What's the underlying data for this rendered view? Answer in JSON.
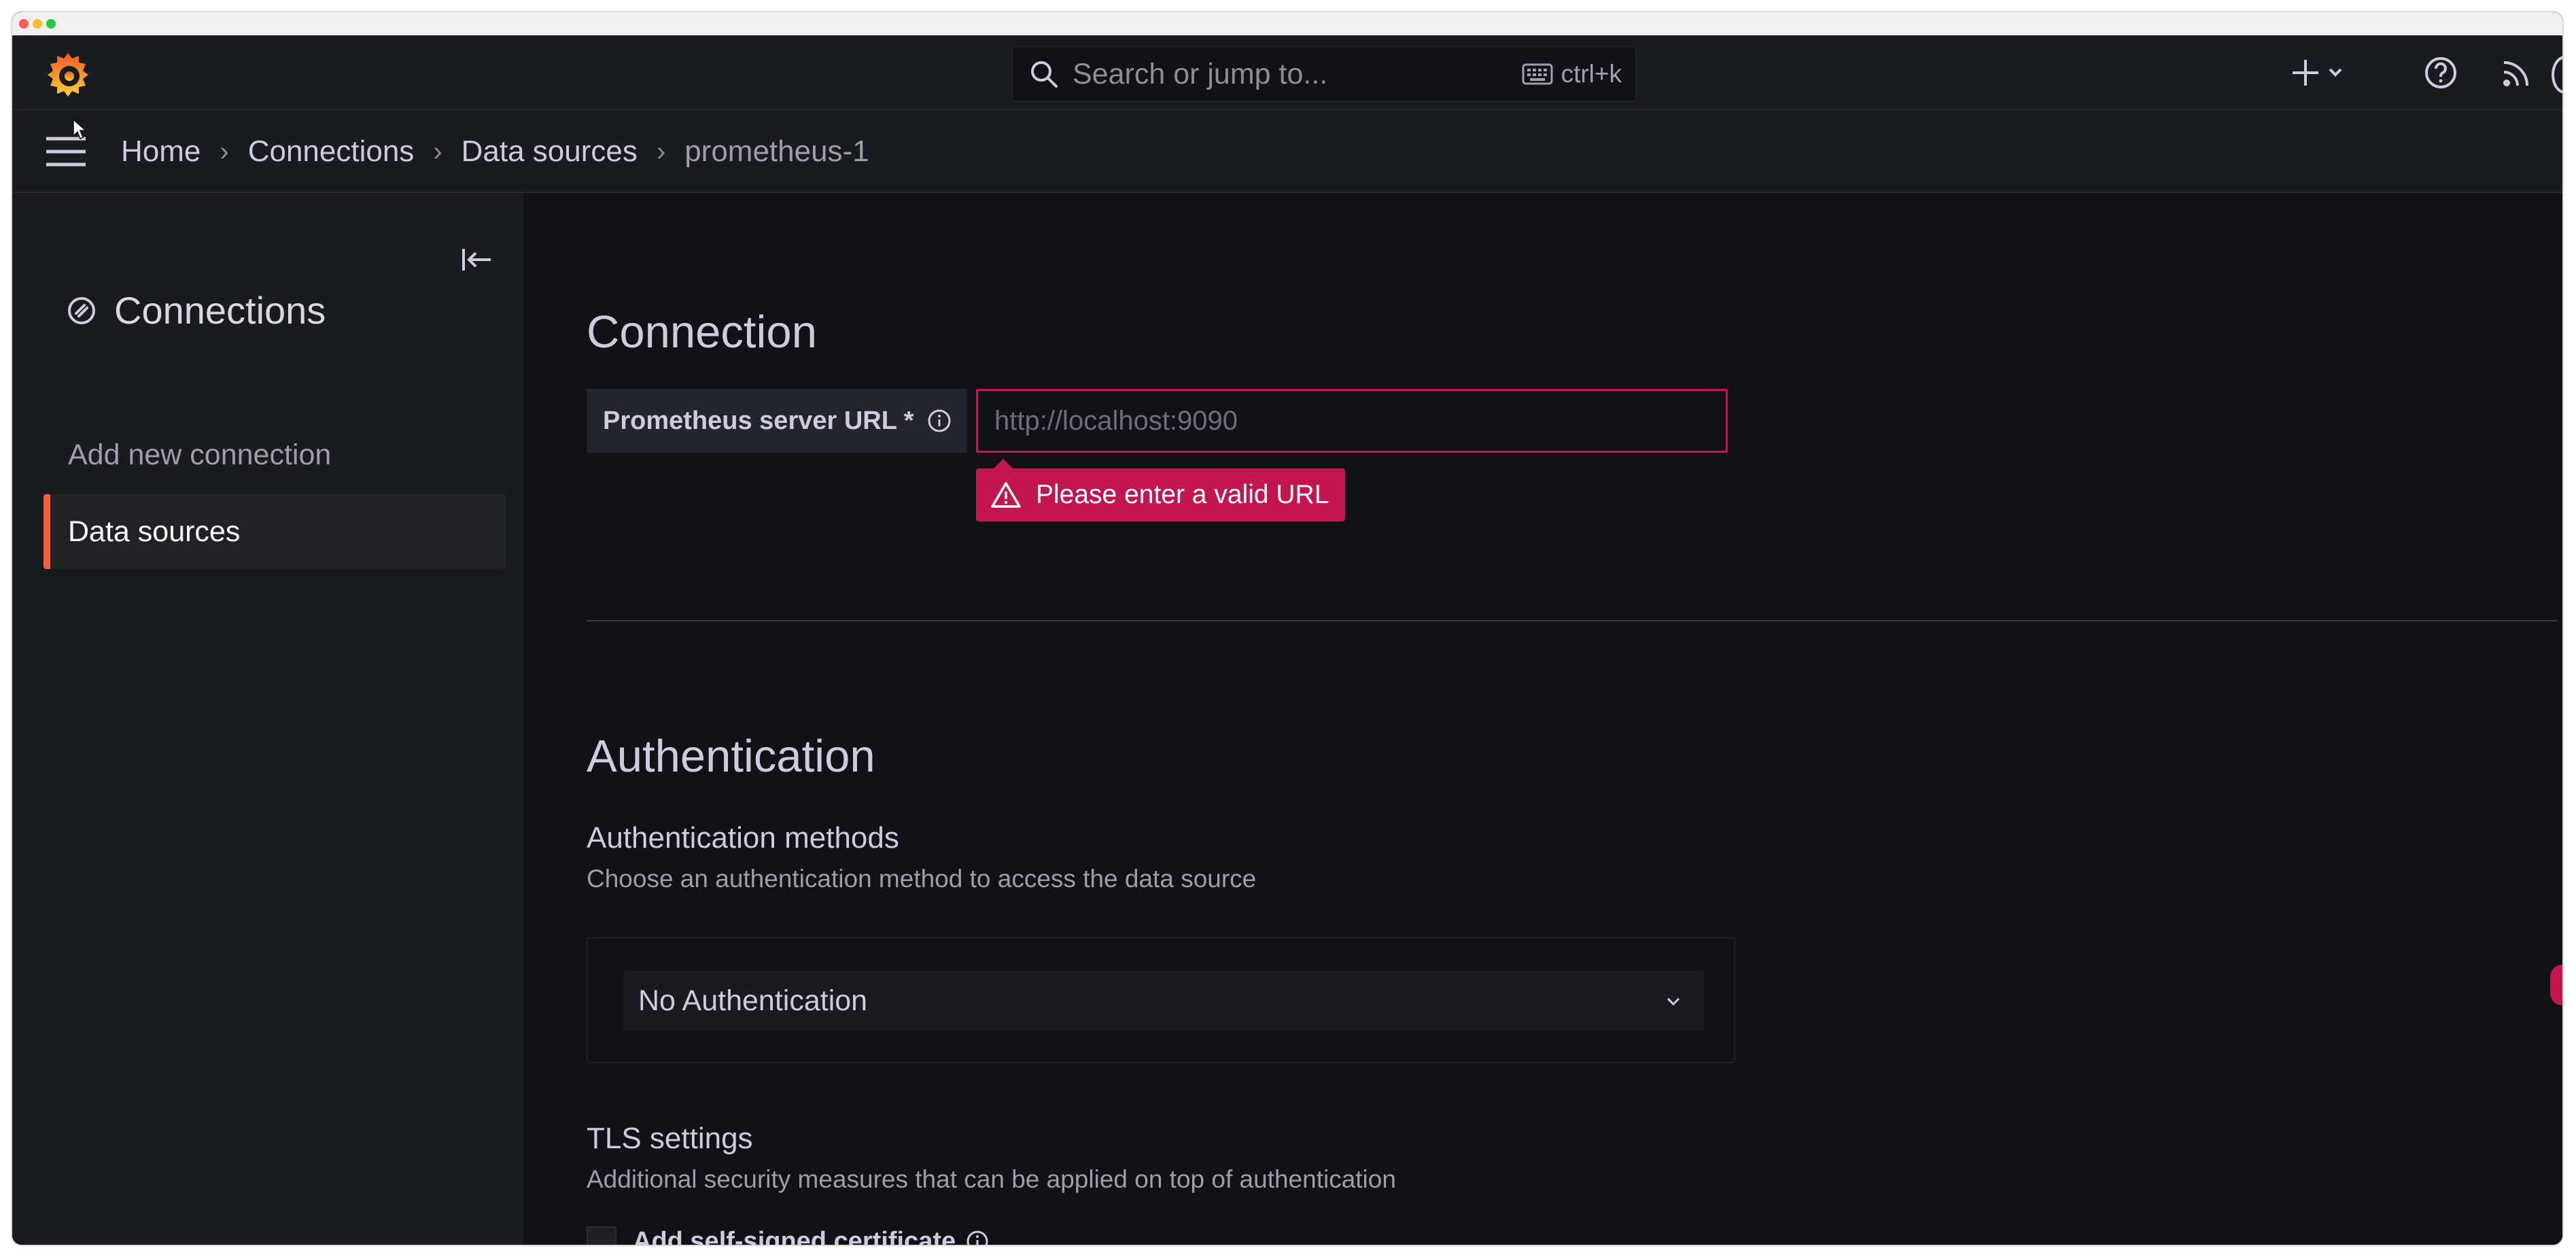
{
  "window": {
    "traffic_lights": [
      "close",
      "minimize",
      "maximize"
    ]
  },
  "topbar": {
    "search_placeholder": "Search or jump to...",
    "search_shortcut": "ctrl+k",
    "icons": [
      "grafana-logo-icon",
      "search-icon",
      "keyboard-icon",
      "plus-icon",
      "chevron-down-icon",
      "help-icon",
      "rss-icon",
      "avatar"
    ]
  },
  "breadcrumb": {
    "items": [
      "Home",
      "Connections",
      "Data sources",
      "prometheus-1"
    ]
  },
  "sidebar": {
    "title": "Connections",
    "items": [
      {
        "label": "Add new connection"
      },
      {
        "label": "Data sources",
        "active": true
      }
    ]
  },
  "main": {
    "connection_heading": "Connection",
    "url_label": "Prometheus server URL *",
    "url_placeholder": "http://localhost:9090",
    "url_value": "",
    "url_error": "Please enter a valid URL",
    "auth_heading": "Authentication",
    "auth_methods_title": "Authentication methods",
    "auth_methods_desc": "Choose an authentication method to access the data source",
    "auth_selected": "No Authentication",
    "tls_title": "TLS settings",
    "tls_desc": "Additional security measures that can be applied on top of authentication",
    "self_signed_label": "Add self-signed certificate"
  },
  "colors": {
    "background": "#111217",
    "panel": "#181b1f",
    "accent": "#f55f3e",
    "error": "#c4164e"
  }
}
